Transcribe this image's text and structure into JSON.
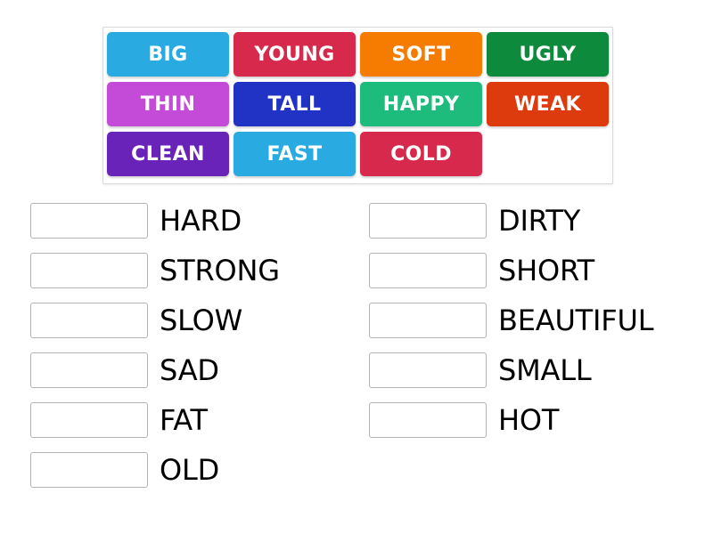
{
  "word_bank": {
    "name": "word-bank",
    "rows": [
      [
        {
          "label": "BIG",
          "color": "#29abe2"
        },
        {
          "label": "YOUNG",
          "color": "#d6294b"
        },
        {
          "label": "SOFT",
          "color": "#f57c00"
        },
        {
          "label": "UGLY",
          "color": "#0e8a3c"
        }
      ],
      [
        {
          "label": "THIN",
          "color": "#c44bd8"
        },
        {
          "label": "TALL",
          "color": "#2033c4"
        },
        {
          "label": "HAPPY",
          "color": "#1dbc7d"
        },
        {
          "label": "WEAK",
          "color": "#dd3a0e"
        }
      ],
      [
        {
          "label": "CLEAN",
          "color": "#6a23b8"
        },
        {
          "label": "FAST",
          "color": "#29abe2"
        },
        {
          "label": "COLD",
          "color": "#d6294b"
        }
      ]
    ]
  },
  "answers": {
    "left_column": [
      {
        "slot_value": "",
        "label": "HARD"
      },
      {
        "slot_value": "",
        "label": "STRONG"
      },
      {
        "slot_value": "",
        "label": "SLOW"
      },
      {
        "slot_value": "",
        "label": "SAD"
      },
      {
        "slot_value": "",
        "label": "FAT"
      },
      {
        "slot_value": "",
        "label": "OLD"
      }
    ],
    "right_column": [
      {
        "slot_value": "",
        "label": "DIRTY"
      },
      {
        "slot_value": "",
        "label": "SHORT"
      },
      {
        "slot_value": "",
        "label": "BEAUTIFUL"
      },
      {
        "slot_value": "",
        "label": "SMALL"
      },
      {
        "slot_value": "",
        "label": "HOT"
      }
    ]
  }
}
